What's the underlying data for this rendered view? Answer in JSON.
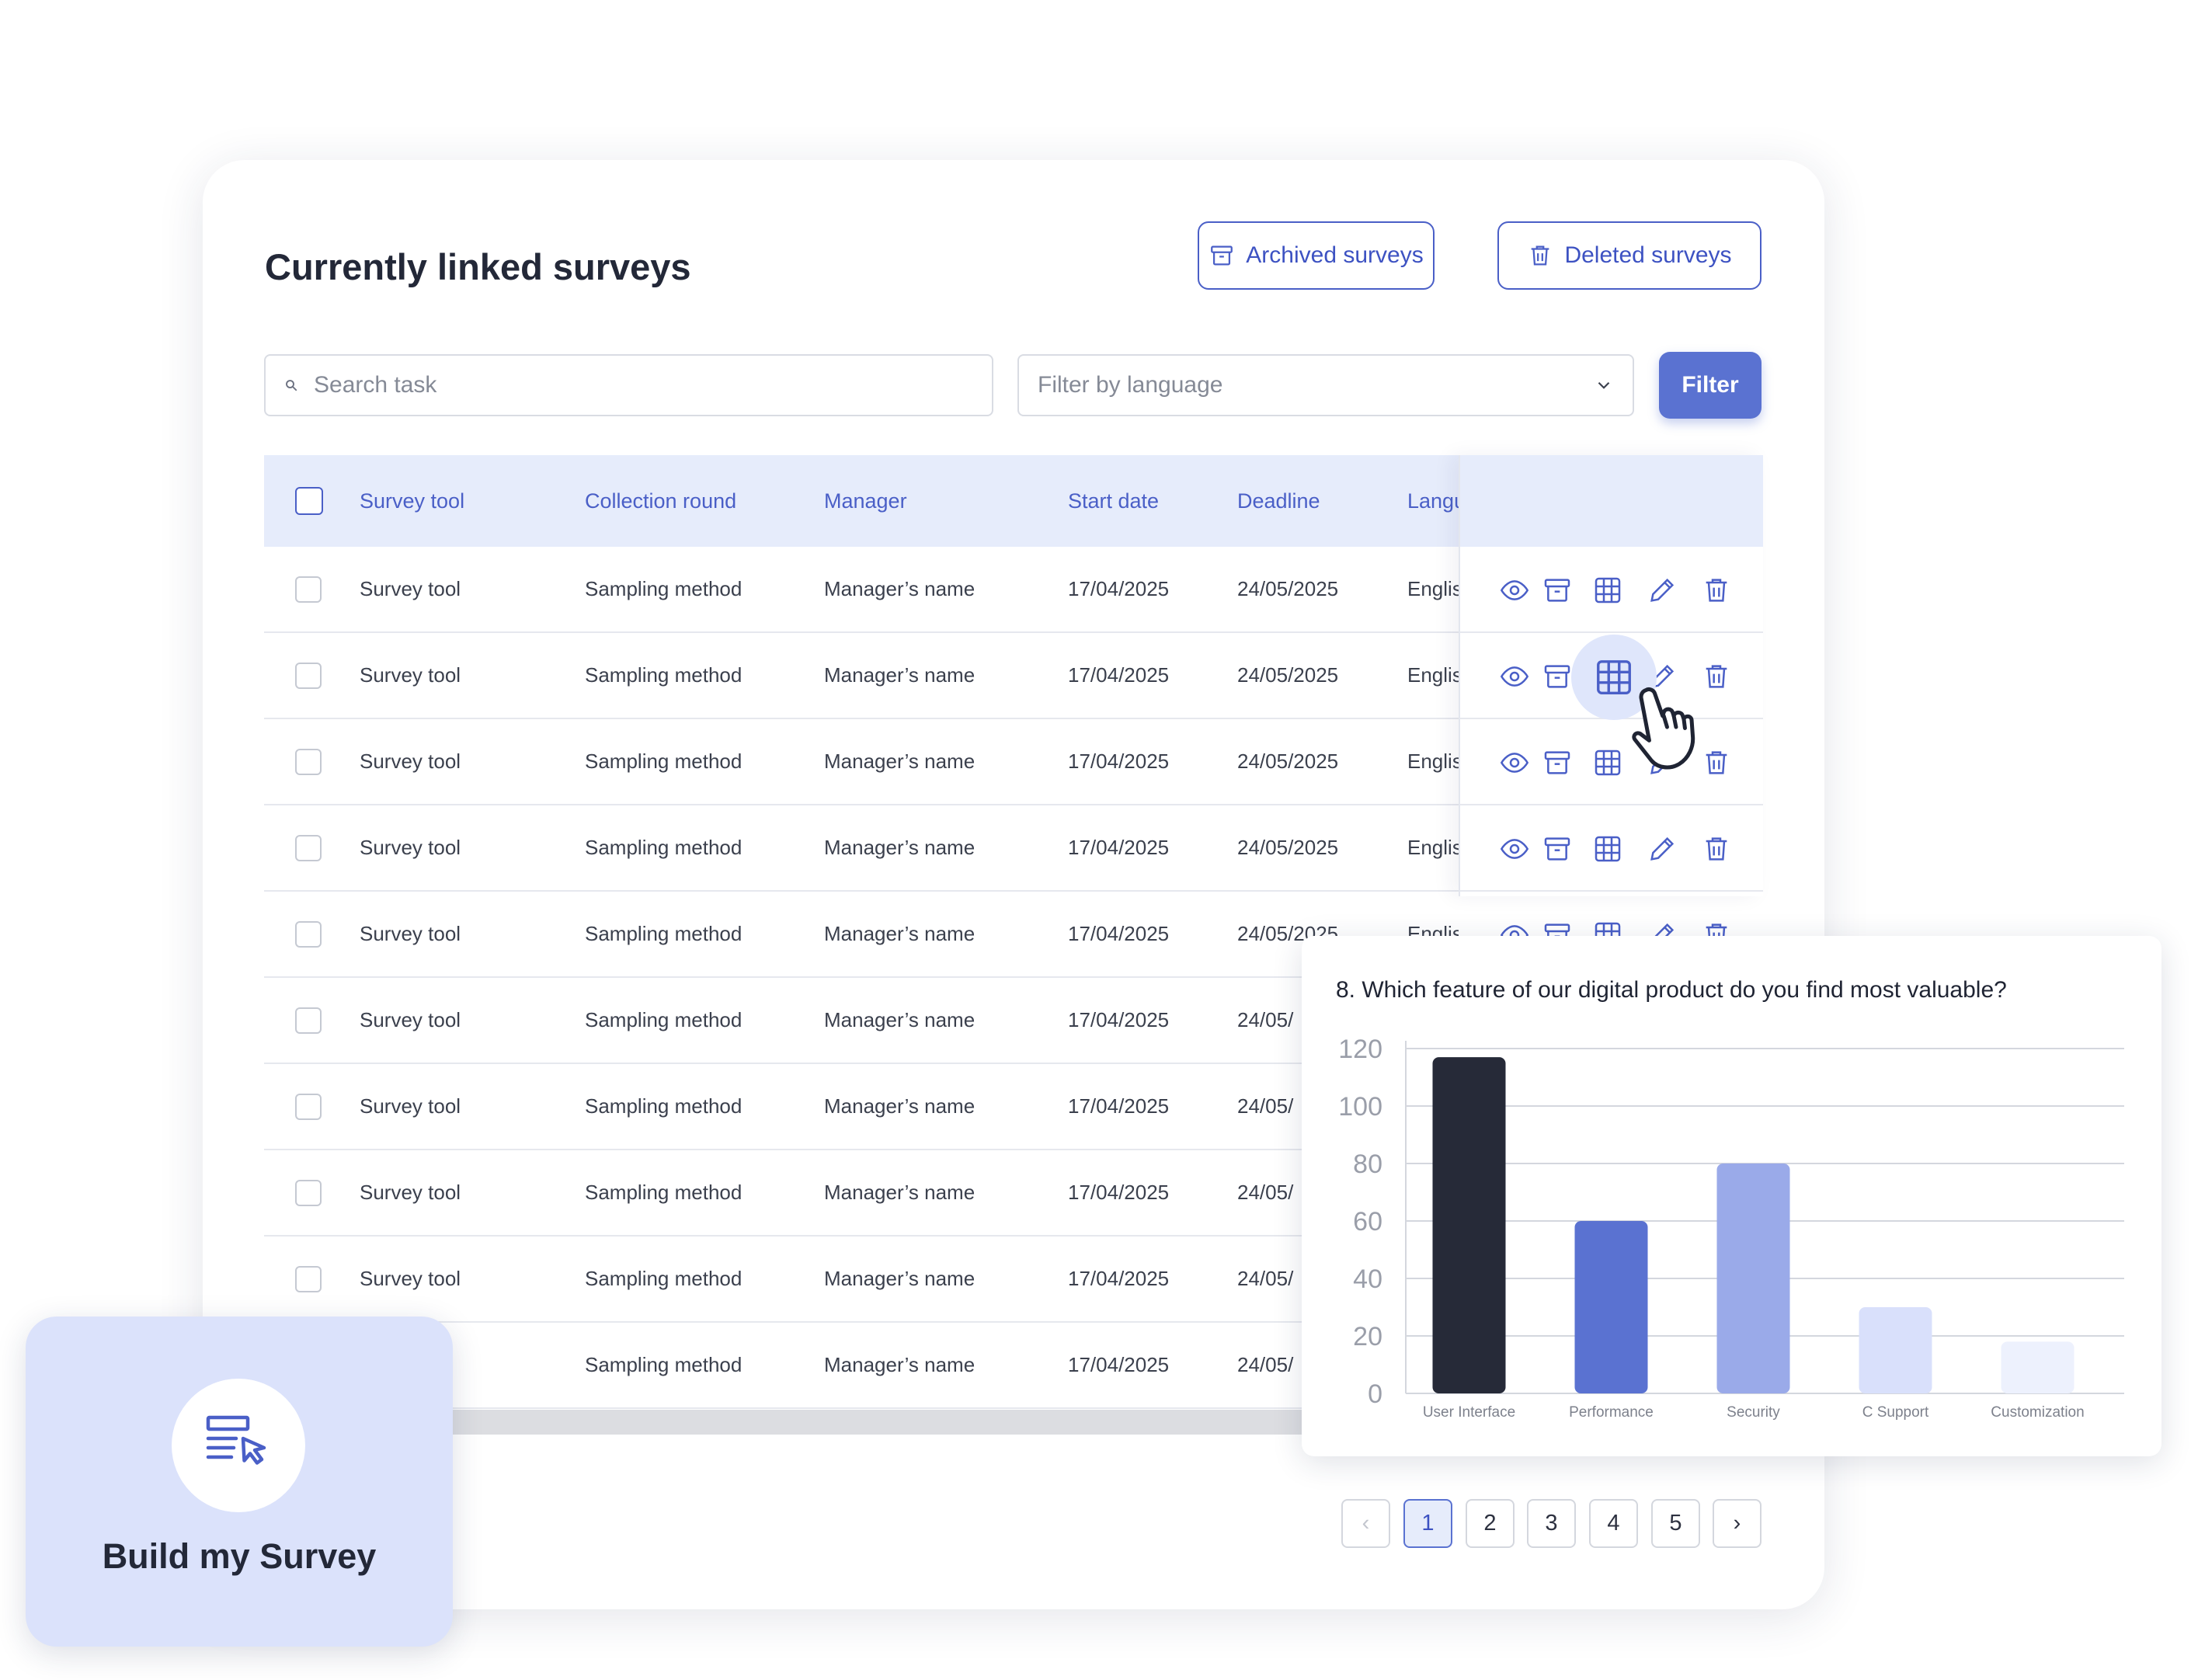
{
  "header": {
    "title": "Currently linked surveys",
    "archived_label": "Archived surveys",
    "deleted_label": "Deleted surveys"
  },
  "filters": {
    "search_placeholder": "Search task",
    "language_placeholder": "Filter by language",
    "filter_label": "Filter"
  },
  "table": {
    "columns": [
      "Survey tool",
      "Collection round",
      "Manager",
      "Start date",
      "Deadline",
      "Langu"
    ],
    "rows": [
      {
        "tool": "Survey tool",
        "round": "Sampling method",
        "manager": "Manager’s name",
        "start": "17/04/2025",
        "deadline": "24/05/2025",
        "lang": "Englis"
      },
      {
        "tool": "Survey tool",
        "round": "Sampling method",
        "manager": "Manager’s name",
        "start": "17/04/2025",
        "deadline": "24/05/2025",
        "lang": "Englis"
      },
      {
        "tool": "Survey tool",
        "round": "Sampling method",
        "manager": "Manager’s name",
        "start": "17/04/2025",
        "deadline": "24/05/2025",
        "lang": "Englis"
      },
      {
        "tool": "Survey tool",
        "round": "Sampling method",
        "manager": "Manager’s name",
        "start": "17/04/2025",
        "deadline": "24/05/2025",
        "lang": "Englis"
      },
      {
        "tool": "Survey tool",
        "round": "Sampling method",
        "manager": "Manager’s name",
        "start": "17/04/2025",
        "deadline": "24/05/2025",
        "lang": "Englis"
      },
      {
        "tool": "Survey tool",
        "round": "Sampling method",
        "manager": "Manager’s name",
        "start": "17/04/2025",
        "deadline": "24/05/",
        "lang": ""
      },
      {
        "tool": "Survey tool",
        "round": "Sampling method",
        "manager": "Manager’s name",
        "start": "17/04/2025",
        "deadline": "24/05/",
        "lang": ""
      },
      {
        "tool": "Survey tool",
        "round": "Sampling method",
        "manager": "Manager’s name",
        "start": "17/04/2025",
        "deadline": "24/05/",
        "lang": ""
      },
      {
        "tool": "Survey tool",
        "round": "Sampling method",
        "manager": "Manager’s name",
        "start": "17/04/2025",
        "deadline": "24/05/",
        "lang": ""
      },
      {
        "tool": "ol",
        "round": "Sampling method",
        "manager": "Manager’s name",
        "start": "17/04/2025",
        "deadline": "24/05/",
        "lang": ""
      }
    ],
    "row_actions": [
      "eye-icon",
      "archive-icon",
      "table-icon",
      "pencil-icon",
      "trash-icon"
    ]
  },
  "pagination": {
    "pages": [
      "1",
      "2",
      "3",
      "4",
      "5"
    ],
    "current": "1",
    "prev_symbol": "‹",
    "next_symbol": "›"
  },
  "chart": {
    "title": "8. Which feature of our digital product do you find most valuable?"
  },
  "chart_data": {
    "type": "bar",
    "title": "8. Which feature of our digital product do you find most valuable?",
    "categories": [
      "User Interface",
      "Performance",
      "Security",
      "C Support",
      "Customization"
    ],
    "values": [
      117,
      60,
      80,
      30,
      18
    ],
    "colors": [
      "#262a38",
      "#5a72d1",
      "#9aaae9",
      "#d9e0fb",
      "#edf1fd"
    ],
    "ylim": [
      0,
      120
    ],
    "yticks": [
      0,
      20,
      40,
      60,
      80,
      100,
      120
    ],
    "grid": true,
    "xlabel": "",
    "ylabel": ""
  },
  "build": {
    "label": "Build my Survey"
  },
  "colors": {
    "accent": "#4a5fc7",
    "header_bg": "#e6ecfb",
    "filter_bg": "#5a72d1",
    "build_bg": "#dbe2fb"
  }
}
